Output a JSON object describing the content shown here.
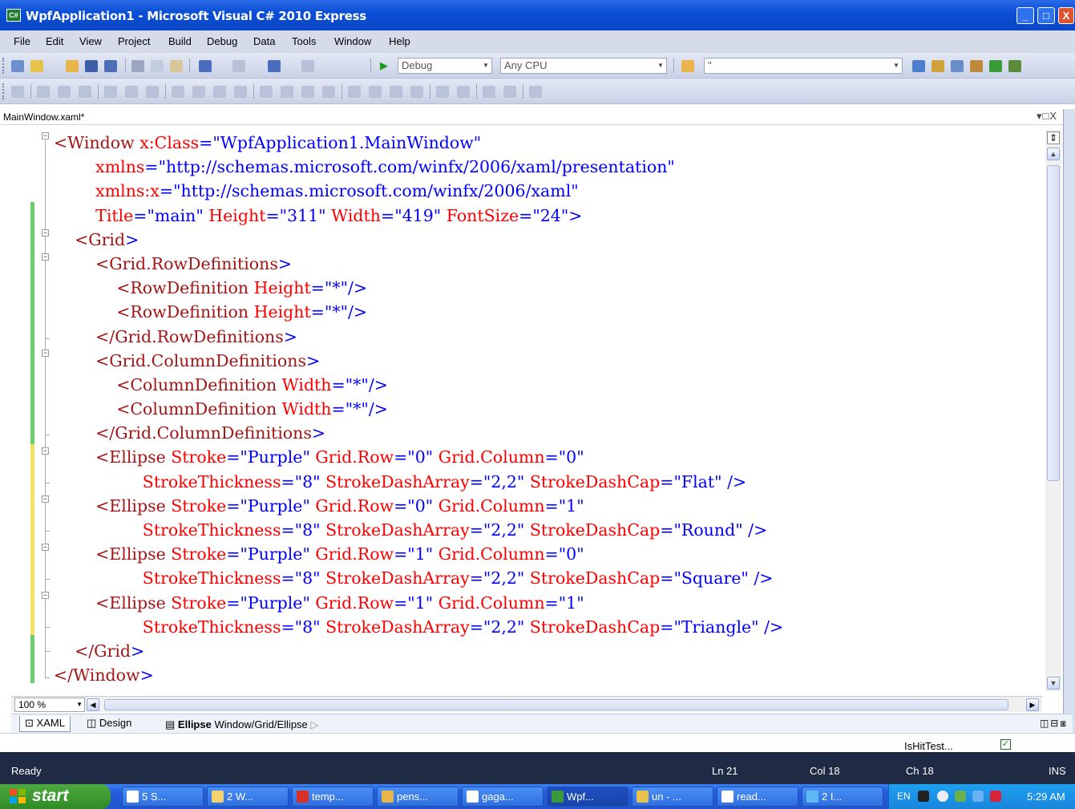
{
  "window": {
    "title": "WpfApplication1 - Microsoft Visual C# 2010 Express",
    "app_icon_text": "C#",
    "minimize": "_",
    "maximize": "□",
    "close": "X"
  },
  "menu": [
    "File",
    "Edit",
    "View",
    "Project",
    "Build",
    "Debug",
    "Data",
    "Tools",
    "Window",
    "Help"
  ],
  "toolbar": {
    "config": "Debug",
    "platform": "Any CPU",
    "find_value": "\""
  },
  "document": {
    "tab_name": "MainWindow.xaml*",
    "tab_controls": "▾□X",
    "code_lines": [
      [
        [
          "tg",
          "<Window "
        ],
        [
          "at",
          "x:Class"
        ],
        [
          "pn",
          "="
        ],
        [
          "vl",
          "\"WpfApplication1.MainWindow\""
        ]
      ],
      [
        [
          "tg",
          "        "
        ],
        [
          "at",
          "xmlns"
        ],
        [
          "pn",
          "="
        ],
        [
          "vl",
          "\"http://schemas.microsoft.com/winfx/2006/xaml/presentation\""
        ]
      ],
      [
        [
          "tg",
          "        "
        ],
        [
          "at",
          "xmlns:x"
        ],
        [
          "pn",
          "="
        ],
        [
          "vl",
          "\"http://schemas.microsoft.com/winfx/2006/xaml\""
        ]
      ],
      [
        [
          "tg",
          "        "
        ],
        [
          "at",
          "Title"
        ],
        [
          "pn",
          "="
        ],
        [
          "vl",
          "\"main\""
        ],
        [
          "tg",
          " "
        ],
        [
          "at",
          "Height"
        ],
        [
          "pn",
          "="
        ],
        [
          "vl",
          "\"311\""
        ],
        [
          "tg",
          " "
        ],
        [
          "at",
          "Width"
        ],
        [
          "pn",
          "="
        ],
        [
          "vl",
          "\"419\""
        ],
        [
          "tg",
          " "
        ],
        [
          "at",
          "FontSize"
        ],
        [
          "pn",
          "="
        ],
        [
          "vl",
          "\"24\""
        ],
        [
          "pn",
          ">"
        ]
      ],
      [
        [
          "tg",
          "    <Grid"
        ],
        [
          "pn",
          ">"
        ]
      ],
      [
        [
          "tg",
          "        <Grid.RowDefinitions"
        ],
        [
          "pn",
          ">"
        ]
      ],
      [
        [
          "tg",
          "            <RowDefinition "
        ],
        [
          "at",
          "Height"
        ],
        [
          "pn",
          "="
        ],
        [
          "vl",
          "\"*\""
        ],
        [
          "pn",
          "/>"
        ]
      ],
      [
        [
          "tg",
          "            <RowDefinition "
        ],
        [
          "at",
          "Height"
        ],
        [
          "pn",
          "="
        ],
        [
          "vl",
          "\"*\""
        ],
        [
          "pn",
          "/>"
        ]
      ],
      [
        [
          "tg",
          "        </Grid.RowDefinitions"
        ],
        [
          "pn",
          ">"
        ]
      ],
      [
        [
          "tg",
          "        <Grid.ColumnDefinitions"
        ],
        [
          "pn",
          ">"
        ]
      ],
      [
        [
          "tg",
          "            <ColumnDefinition "
        ],
        [
          "at",
          "Width"
        ],
        [
          "pn",
          "="
        ],
        [
          "vl",
          "\"*\""
        ],
        [
          "pn",
          "/>"
        ]
      ],
      [
        [
          "tg",
          "            <ColumnDefinition "
        ],
        [
          "at",
          "Width"
        ],
        [
          "pn",
          "="
        ],
        [
          "vl",
          "\"*\""
        ],
        [
          "pn",
          "/>"
        ]
      ],
      [
        [
          "tg",
          "        </Grid.ColumnDefinitions"
        ],
        [
          "pn",
          ">"
        ]
      ],
      [
        [
          "tg",
          "        <Ellipse "
        ],
        [
          "at",
          "Stroke"
        ],
        [
          "pn",
          "="
        ],
        [
          "vl",
          "\"Purple\""
        ],
        [
          "tg",
          " "
        ],
        [
          "at",
          "Grid.Row"
        ],
        [
          "pn",
          "="
        ],
        [
          "vl",
          "\"0\""
        ],
        [
          "tg",
          " "
        ],
        [
          "at",
          "Grid.Column"
        ],
        [
          "pn",
          "="
        ],
        [
          "vl",
          "\"0\""
        ]
      ],
      [
        [
          "tg",
          "                 "
        ],
        [
          "at",
          "StrokeThickness"
        ],
        [
          "pn",
          "="
        ],
        [
          "vl",
          "\"8\""
        ],
        [
          "tg",
          " "
        ],
        [
          "at",
          "StrokeDashArray"
        ],
        [
          "pn",
          "="
        ],
        [
          "vl",
          "\"2,2\""
        ],
        [
          "tg",
          " "
        ],
        [
          "at",
          "StrokeDashCap"
        ],
        [
          "pn",
          "="
        ],
        [
          "vl",
          "\"Flat\""
        ],
        [
          "tg",
          " "
        ],
        [
          "pn",
          "/>"
        ]
      ],
      [
        [
          "tg",
          "        <Ellipse "
        ],
        [
          "at",
          "Stroke"
        ],
        [
          "pn",
          "="
        ],
        [
          "vl",
          "\"Purple\""
        ],
        [
          "tg",
          " "
        ],
        [
          "at",
          "Grid.Row"
        ],
        [
          "pn",
          "="
        ],
        [
          "vl",
          "\"0\""
        ],
        [
          "tg",
          " "
        ],
        [
          "at",
          "Grid.Column"
        ],
        [
          "pn",
          "="
        ],
        [
          "vl",
          "\"1\""
        ]
      ],
      [
        [
          "tg",
          "                 "
        ],
        [
          "at",
          "StrokeThickness"
        ],
        [
          "pn",
          "="
        ],
        [
          "vl",
          "\"8\""
        ],
        [
          "tg",
          " "
        ],
        [
          "at",
          "StrokeDashArray"
        ],
        [
          "pn",
          "="
        ],
        [
          "vl",
          "\"2,2\""
        ],
        [
          "tg",
          " "
        ],
        [
          "at",
          "StrokeDashCap"
        ],
        [
          "pn",
          "="
        ],
        [
          "vl",
          "\"Round\""
        ],
        [
          "tg",
          " "
        ],
        [
          "pn",
          "/>"
        ]
      ],
      [
        [
          "tg",
          "        <Ellipse "
        ],
        [
          "at",
          "Stroke"
        ],
        [
          "pn",
          "="
        ],
        [
          "vl",
          "\"Purple\""
        ],
        [
          "tg",
          " "
        ],
        [
          "at",
          "Grid.Row"
        ],
        [
          "pn",
          "="
        ],
        [
          "vl",
          "\"1\""
        ],
        [
          "tg",
          " "
        ],
        [
          "at",
          "Grid.Column"
        ],
        [
          "pn",
          "="
        ],
        [
          "vl",
          "\"0\""
        ]
      ],
      [
        [
          "tg",
          "                 "
        ],
        [
          "at",
          "StrokeThickness"
        ],
        [
          "pn",
          "="
        ],
        [
          "vl",
          "\"8\""
        ],
        [
          "tg",
          " "
        ],
        [
          "at",
          "StrokeDashArray"
        ],
        [
          "pn",
          "="
        ],
        [
          "vl",
          "\"2,2\""
        ],
        [
          "tg",
          " "
        ],
        [
          "at",
          "StrokeDashCap"
        ],
        [
          "pn",
          "="
        ],
        [
          "vl",
          "\"Square\""
        ],
        [
          "tg",
          " "
        ],
        [
          "pn",
          "/>"
        ]
      ],
      [
        [
          "tg",
          "        <Ellipse "
        ],
        [
          "at",
          "Stroke"
        ],
        [
          "pn",
          "="
        ],
        [
          "vl",
          "\"Purple\""
        ],
        [
          "tg",
          " "
        ],
        [
          "at",
          "Grid.Row"
        ],
        [
          "pn",
          "="
        ],
        [
          "vl",
          "\"1\""
        ],
        [
          "tg",
          " "
        ],
        [
          "at",
          "Grid.Column"
        ],
        [
          "pn",
          "="
        ],
        [
          "vl",
          "\"1\""
        ]
      ],
      [
        [
          "tg",
          "                 "
        ],
        [
          "at",
          "StrokeThickness"
        ],
        [
          "pn",
          "="
        ],
        [
          "vl",
          "\"8\""
        ],
        [
          "tg",
          " "
        ],
        [
          "at",
          "StrokeDashArray"
        ],
        [
          "pn",
          "="
        ],
        [
          "vl",
          "\"2,2\""
        ],
        [
          "tg",
          " "
        ],
        [
          "at",
          "StrokeDashCap"
        ],
        [
          "pn",
          "="
        ],
        [
          "vl",
          "\"Triangle\""
        ],
        [
          "tg",
          " "
        ],
        [
          "pn",
          "/>"
        ]
      ],
      [
        [
          "tg",
          "    </Grid"
        ],
        [
          "pn",
          ">"
        ]
      ],
      [
        [
          "tg",
          "</Window"
        ],
        [
          "pn",
          ">"
        ]
      ]
    ]
  },
  "editor_footer": {
    "zoom": "100 %",
    "tab_xaml": "XAML",
    "tab_design": "Design",
    "crumb_bold": "Ellipse",
    "crumb_path": "Window/Grid/Ellipse",
    "view_buttons": "◫⊟⧆"
  },
  "properties": {
    "ishittest_label": "IsHitTest..."
  },
  "status": {
    "ready": "Ready",
    "ln": "Ln 21",
    "col": "Col 18",
    "ch": "Ch 18",
    "ins": "INS"
  },
  "taskbar": {
    "start": "start",
    "tasks": [
      {
        "label": "5 S...",
        "color": "#ffffff"
      },
      {
        "label": "2 W...",
        "color": "#f5d36a"
      },
      {
        "label": "temp...",
        "color": "#d93025"
      },
      {
        "label": "pens...",
        "color": "#e9b44a"
      },
      {
        "label": "gaga...",
        "color": "#ffffff"
      },
      {
        "label": "Wpf...",
        "color": "#3a9a3a"
      },
      {
        "label": "un - ...",
        "color": "#e6c24a"
      },
      {
        "label": "read...",
        "color": "#ffffff"
      },
      {
        "label": "2 I...",
        "color": "#5fb8f5"
      }
    ],
    "lang": "EN",
    "clock": "5:29 AM"
  },
  "colors": {
    "tag": "#a31515",
    "attribute": "#ff0000",
    "value": "#0000ff",
    "titlebar": "#0b4fd6",
    "statusbar": "#1f2a44"
  }
}
